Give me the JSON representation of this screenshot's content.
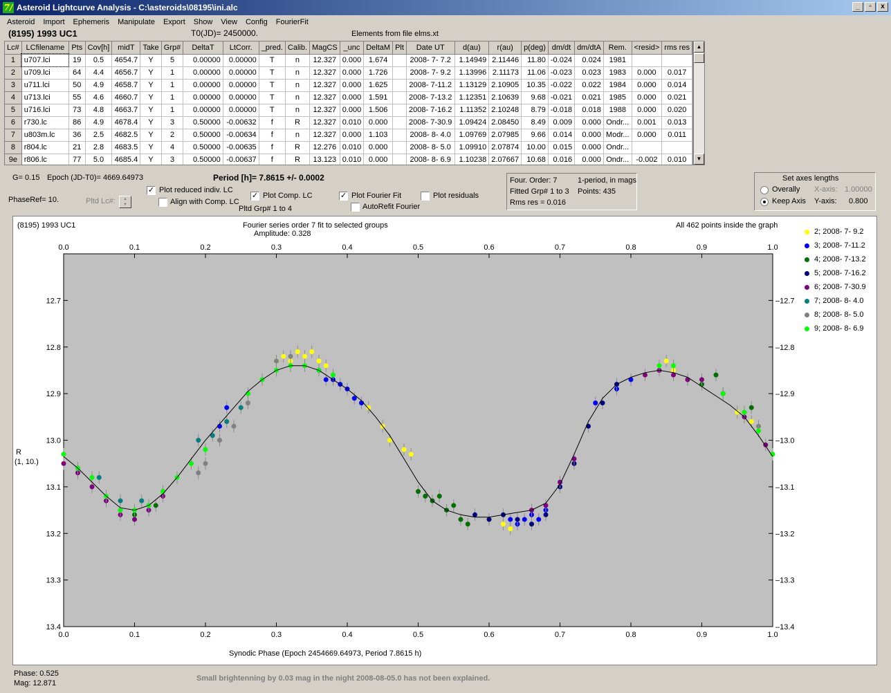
{
  "window": {
    "title": "Asteroid Lightcurve Analysis - C:\\asteroids\\08195\\ini.alc",
    "app_icon": "7/",
    "minimize": "_",
    "maximize": "▫",
    "close": "x"
  },
  "menu": [
    "Asteroid",
    "Import",
    "Ephemeris",
    "Manipulate",
    "Export",
    "Show",
    "View",
    "Config",
    "FourierFit"
  ],
  "header": {
    "object": "(8195) 1993 UC1",
    "t0": "T0(JD)= 2450000.",
    "elements": "Elements from file elms.xt"
  },
  "table": {
    "columns": [
      "Lc#",
      "LCfilename",
      "Pts",
      "Cov[h]",
      "midT",
      "Take",
      "Grp#",
      "DeltaT",
      "LtCorr.",
      "_pred.",
      "Calib.",
      "MagCS",
      "_unc",
      "DeltaM",
      "Plt",
      "Date UT",
      "d(au)",
      "r(au)",
      "p(deg)",
      "dm/dt",
      "dm/dtA",
      "Rem.",
      "<resid>",
      "rms res"
    ],
    "rows": [
      [
        "1",
        "u707.lci",
        "19",
        "0.5",
        "4654.7",
        "Y",
        "5",
        "0.00000",
        "0.00000",
        "T",
        "n",
        "12.327",
        "0.000",
        "1.674",
        "",
        "2008- 7- 7.2",
        "1.14949",
        "2.11446",
        "11.80",
        "-0.024",
        "0.024",
        "1981",
        "",
        ""
      ],
      [
        "2",
        "u709.lci",
        "64",
        "4.4",
        "4656.7",
        "Y",
        "1",
        "0.00000",
        "0.00000",
        "T",
        "n",
        "12.327",
        "0.000",
        "1.726",
        "",
        "2008- 7- 9.2",
        "1.13996",
        "2.11173",
        "11.06",
        "-0.023",
        "0.023",
        "1983",
        "0.000",
        "0.017"
      ],
      [
        "3",
        "u711.lci",
        "50",
        "4.9",
        "4658.7",
        "Y",
        "1",
        "0.00000",
        "0.00000",
        "T",
        "n",
        "12.327",
        "0.000",
        "1.625",
        "",
        "2008- 7-11.2",
        "1.13129",
        "2.10905",
        "10.35",
        "-0.022",
        "0.022",
        "1984",
        "0.000",
        "0.014"
      ],
      [
        "4",
        "u713.lci",
        "55",
        "4.6",
        "4660.7",
        "Y",
        "1",
        "0.00000",
        "0.00000",
        "T",
        "n",
        "12.327",
        "0.000",
        "1.591",
        "",
        "2008- 7-13.2",
        "1.12351",
        "2.10639",
        "9.68",
        "-0.021",
        "0.021",
        "1985",
        "0.000",
        "0.021"
      ],
      [
        "5",
        "u716.lci",
        "73",
        "4.8",
        "4663.7",
        "Y",
        "1",
        "0.00000",
        "0.00000",
        "T",
        "n",
        "12.327",
        "0.000",
        "1.506",
        "",
        "2008- 7-16.2",
        "1.11352",
        "2.10248",
        "8.79",
        "-0.018",
        "0.018",
        "1988",
        "0.000",
        "0.020"
      ],
      [
        "6",
        "r730.lc",
        "86",
        "4.9",
        "4678.4",
        "Y",
        "3",
        "0.50000",
        "-0.00632",
        "f",
        "R",
        "12.327",
        "0.010",
        "0.000",
        "",
        "2008- 7-30.9",
        "1.09424",
        "2.08450",
        "8.49",
        "0.009",
        "0.000",
        "Ondr...",
        "0.001",
        "0.013"
      ],
      [
        "7",
        "u803m.lc",
        "36",
        "2.5",
        "4682.5",
        "Y",
        "2",
        "0.50000",
        "-0.00634",
        "f",
        "n",
        "12.327",
        "0.000",
        "1.103",
        "",
        "2008- 8- 4.0",
        "1.09769",
        "2.07985",
        "9.66",
        "0.014",
        "0.000",
        "Modr...",
        "0.000",
        "0.011"
      ],
      [
        "8",
        "r804.lc",
        "21",
        "2.8",
        "4683.5",
        "Y",
        "4",
        "0.50000",
        "-0.00635",
        "f",
        "R",
        "12.276",
        "0.010",
        "0.000",
        "",
        "2008- 8- 5.0",
        "1.09910",
        "2.07874",
        "10.00",
        "0.015",
        "0.000",
        "Ondr...",
        "",
        ""
      ],
      [
        "9e",
        "r806.lc",
        "77",
        "5.0",
        "4685.4",
        "Y",
        "3",
        "0.50000",
        "-0.00637",
        "f",
        "R",
        "13.123",
        "0.010",
        "0.000",
        "",
        "2008- 8- 6.9",
        "1.10238",
        "2.07667",
        "10.68",
        "0.016",
        "0.000",
        "Ondr...",
        "-0.002",
        "0.010"
      ]
    ]
  },
  "controls": {
    "g": "G= 0.15",
    "epoch": "Epoch (JD-T0)= 4669.64973",
    "period": "Period [h]= 7.8615 +/- 0.0002",
    "phaseref": "PhaseRef= 10.",
    "pltd_lc": "Pltd Lc#:",
    "plot_reduced": "Plot reduced indiv. LC",
    "align_comp": "Align with Comp. LC",
    "plot_comp": "Plot Comp. LC",
    "pltd_grp": "Pltd Grp#  1   to    4",
    "plot_fourier": "Plot Fourier Fit",
    "autorefit": "AutoRefit Fourier",
    "plot_residuals": "Plot residuals",
    "check": "✓"
  },
  "fourier_panel": {
    "order": "Four. Order:  7",
    "mode": "1-period, in mags",
    "fitted": "Fitted Grp# 1 to 3",
    "points": "Points: 435",
    "rms": "Rms res      = 0.016"
  },
  "axes_panel": {
    "title": "Set axes lengths",
    "overally": "Overally",
    "keep": "Keep Axis",
    "xaxis_label": "X-axis:",
    "xaxis_value": "1.00000",
    "yaxis_label": "Y-axis:",
    "yaxis_value": "0.800"
  },
  "plot": {
    "name": "(8195) 1993 UC1",
    "title1": "Fourier series order 7 fit to selected groups",
    "title2": "Amplitude: 0.328",
    "info": "All 462 points inside the graph",
    "xlabel": "Synodic Phase (Epoch 2454669.64973, Period 7.8615 h)",
    "ylabel1": "R",
    "ylabel2": "(1, 10.)",
    "bg_color": "#c0c0c0"
  },
  "chart_data": {
    "type": "scatter",
    "xlim": [
      0.0,
      1.0
    ],
    "ylim": [
      13.4,
      12.6
    ],
    "x_ticks": [
      "0.0",
      "0.1",
      "0.2",
      "0.3",
      "0.4",
      "0.5",
      "0.6",
      "0.7",
      "0.8",
      "0.9",
      "1.0"
    ],
    "y_ticks": [
      "12.7",
      "12.8",
      "12.9",
      "13.0",
      "13.1",
      "13.2",
      "13.3",
      "13.4"
    ],
    "y_tick_values": [
      12.7,
      12.8,
      12.9,
      13.0,
      13.1,
      13.2,
      13.3,
      13.4
    ],
    "fit_curve": [
      [
        0.0,
        13.035
      ],
      [
        0.02,
        13.06
      ],
      [
        0.04,
        13.09
      ],
      [
        0.06,
        13.12
      ],
      [
        0.08,
        13.145
      ],
      [
        0.1,
        13.15
      ],
      [
        0.12,
        13.14
      ],
      [
        0.14,
        13.115
      ],
      [
        0.16,
        13.08
      ],
      [
        0.18,
        13.04
      ],
      [
        0.2,
        13.0
      ],
      [
        0.22,
        12.965
      ],
      [
        0.24,
        12.93
      ],
      [
        0.26,
        12.895
      ],
      [
        0.28,
        12.87
      ],
      [
        0.3,
        12.85
      ],
      [
        0.32,
        12.84
      ],
      [
        0.34,
        12.84
      ],
      [
        0.36,
        12.85
      ],
      [
        0.38,
        12.87
      ],
      [
        0.4,
        12.89
      ],
      [
        0.42,
        12.915
      ],
      [
        0.44,
        12.95
      ],
      [
        0.46,
        12.99
      ],
      [
        0.48,
        13.04
      ],
      [
        0.5,
        13.09
      ],
      [
        0.52,
        13.13
      ],
      [
        0.54,
        13.15
      ],
      [
        0.56,
        13.16
      ],
      [
        0.58,
        13.165
      ],
      [
        0.6,
        13.165
      ],
      [
        0.62,
        13.16
      ],
      [
        0.64,
        13.155
      ],
      [
        0.66,
        13.15
      ],
      [
        0.68,
        13.135
      ],
      [
        0.7,
        13.095
      ],
      [
        0.72,
        13.03
      ],
      [
        0.74,
        12.96
      ],
      [
        0.76,
        12.91
      ],
      [
        0.78,
        12.88
      ],
      [
        0.8,
        12.865
      ],
      [
        0.82,
        12.855
      ],
      [
        0.84,
        12.85
      ],
      [
        0.86,
        12.855
      ],
      [
        0.88,
        12.865
      ],
      [
        0.9,
        12.885
      ],
      [
        0.92,
        12.905
      ],
      [
        0.94,
        12.925
      ],
      [
        0.96,
        12.95
      ],
      [
        0.98,
        12.99
      ],
      [
        1.0,
        13.035
      ]
    ],
    "series": [
      {
        "name": "2; 2008- 7- 9.2",
        "color": "#ffff00",
        "points": [
          [
            0.3,
            12.83
          ],
          [
            0.31,
            12.82
          ],
          [
            0.32,
            12.83
          ],
          [
            0.33,
            12.81
          ],
          [
            0.34,
            12.82
          ],
          [
            0.35,
            12.81
          ],
          [
            0.36,
            12.83
          ],
          [
            0.37,
            12.84
          ],
          [
            0.43,
            12.93
          ],
          [
            0.45,
            12.97
          ],
          [
            0.46,
            13.0
          ],
          [
            0.48,
            13.02
          ],
          [
            0.49,
            13.03
          ],
          [
            0.6,
            13.17
          ],
          [
            0.62,
            13.18
          ],
          [
            0.63,
            13.19
          ],
          [
            0.82,
            12.86
          ],
          [
            0.84,
            12.84
          ],
          [
            0.85,
            12.83
          ],
          [
            0.86,
            12.85
          ],
          [
            0.95,
            12.94
          ],
          [
            0.97,
            12.96
          ]
        ]
      },
      {
        "name": "3; 2008- 7-11.2",
        "color": "#0000ff",
        "points": [
          [
            0.36,
            12.85
          ],
          [
            0.37,
            12.87
          ],
          [
            0.38,
            12.87
          ],
          [
            0.39,
            12.88
          ],
          [
            0.4,
            12.89
          ],
          [
            0.41,
            12.91
          ],
          [
            0.42,
            12.92
          ],
          [
            0.63,
            13.17
          ],
          [
            0.64,
            13.18
          ],
          [
            0.65,
            13.17
          ],
          [
            0.66,
            13.16
          ],
          [
            0.67,
            13.17
          ],
          [
            0.68,
            13.15
          ],
          [
            0.22,
            12.97
          ],
          [
            0.23,
            12.93
          ],
          [
            0.75,
            12.92
          ],
          [
            0.78,
            12.89
          ],
          [
            0.8,
            12.87
          ]
        ]
      },
      {
        "name": "4; 2008- 7-13.2",
        "color": "#007000",
        "points": [
          [
            0.5,
            13.11
          ],
          [
            0.51,
            13.12
          ],
          [
            0.52,
            13.13
          ],
          [
            0.53,
            13.12
          ],
          [
            0.54,
            13.15
          ],
          [
            0.55,
            13.14
          ],
          [
            0.56,
            13.17
          ],
          [
            0.57,
            13.18
          ],
          [
            0.88,
            12.87
          ],
          [
            0.9,
            12.88
          ],
          [
            0.92,
            12.86
          ],
          [
            0.97,
            12.93
          ],
          [
            0.13,
            13.14
          ],
          [
            0.1,
            13.16
          ]
        ]
      },
      {
        "name": "5; 2008- 7-16.2",
        "color": "#000080",
        "points": [
          [
            0.58,
            13.16
          ],
          [
            0.6,
            13.17
          ],
          [
            0.62,
            13.16
          ],
          [
            0.64,
            13.17
          ],
          [
            0.66,
            13.18
          ],
          [
            0.68,
            13.16
          ],
          [
            0.7,
            13.1
          ],
          [
            0.72,
            13.05
          ],
          [
            0.74,
            12.97
          ],
          [
            0.76,
            12.92
          ],
          [
            0.78,
            12.88
          ]
        ]
      },
      {
        "name": "6; 2008- 7-30.9",
        "color": "#800080",
        "points": [
          [
            0.0,
            13.05
          ],
          [
            0.02,
            13.07
          ],
          [
            0.04,
            13.1
          ],
          [
            0.06,
            13.13
          ],
          [
            0.08,
            13.16
          ],
          [
            0.1,
            13.17
          ],
          [
            0.12,
            13.15
          ],
          [
            0.14,
            13.12
          ],
          [
            0.66,
            13.15
          ],
          [
            0.68,
            13.14
          ],
          [
            0.7,
            13.09
          ],
          [
            0.72,
            13.04
          ],
          [
            0.82,
            12.86
          ],
          [
            0.84,
            12.85
          ],
          [
            0.86,
            12.86
          ],
          [
            0.88,
            12.87
          ],
          [
            0.9,
            12.87
          ],
          [
            0.93,
            12.9
          ],
          [
            0.96,
            12.95
          ],
          [
            0.99,
            13.01
          ]
        ]
      },
      {
        "name": "7; 2008- 8- 4.0",
        "color": "#008080",
        "points": [
          [
            0.02,
            13.06
          ],
          [
            0.05,
            13.08
          ],
          [
            0.08,
            13.13
          ],
          [
            0.11,
            13.13
          ],
          [
            0.14,
            13.11
          ],
          [
            0.19,
            13.0
          ],
          [
            0.21,
            12.99
          ],
          [
            0.23,
            12.96
          ],
          [
            0.25,
            12.93
          ]
        ]
      },
      {
        "name": "8; 2008- 8- 5.0",
        "color": "#808080",
        "points": [
          [
            0.19,
            13.07
          ],
          [
            0.2,
            13.05
          ],
          [
            0.22,
            13.0
          ],
          [
            0.24,
            12.97
          ],
          [
            0.26,
            12.92
          ],
          [
            0.28,
            12.87
          ],
          [
            0.3,
            12.83
          ],
          [
            0.32,
            12.82
          ],
          [
            0.96,
            12.94
          ],
          [
            0.98,
            12.97
          ]
        ]
      },
      {
        "name": "9; 2008- 8- 6.9",
        "color": "#00ff00",
        "points": [
          [
            0.0,
            13.03
          ],
          [
            0.02,
            13.06
          ],
          [
            0.04,
            13.08
          ],
          [
            0.06,
            13.12
          ],
          [
            0.08,
            13.15
          ],
          [
            0.1,
            13.15
          ],
          [
            0.12,
            13.14
          ],
          [
            0.14,
            13.11
          ],
          [
            0.16,
            13.08
          ],
          [
            0.18,
            13.05
          ],
          [
            0.2,
            13.02
          ],
          [
            0.26,
            12.9
          ],
          [
            0.28,
            12.87
          ],
          [
            0.3,
            12.85
          ],
          [
            0.32,
            12.84
          ],
          [
            0.34,
            12.84
          ],
          [
            0.36,
            12.85
          ],
          [
            0.38,
            12.86
          ],
          [
            0.84,
            12.84
          ],
          [
            0.86,
            12.84
          ],
          [
            0.93,
            12.9
          ],
          [
            0.96,
            12.94
          ],
          [
            0.98,
            12.98
          ],
          [
            1.0,
            13.03
          ]
        ]
      }
    ]
  },
  "status": {
    "phase": "Phase:  0.525",
    "mag": "Mag:    12.871",
    "note": "Small brightenning by 0.03 mag in the night 2008-08-05.0 has not been explained."
  }
}
